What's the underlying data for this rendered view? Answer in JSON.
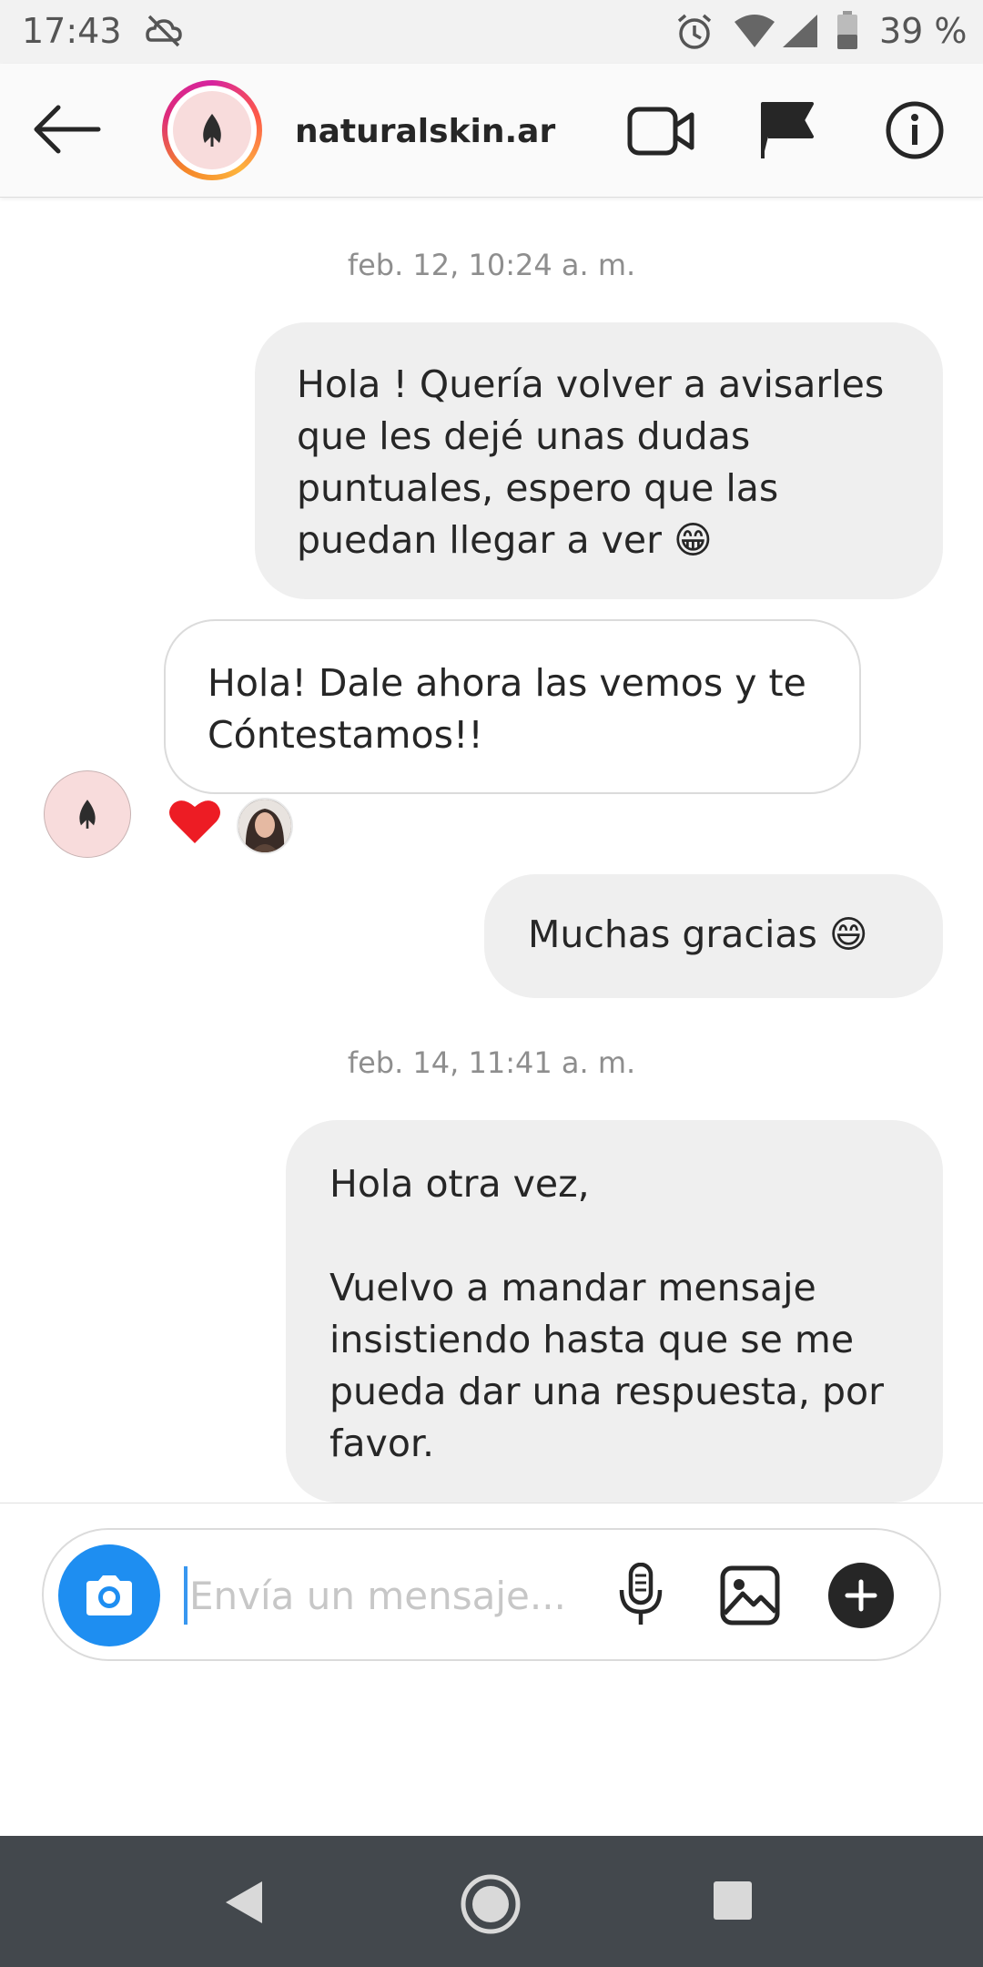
{
  "status_bar": {
    "time": "17:43",
    "battery": "39 %",
    "icons": [
      "sync-off-icon",
      "alarm-icon",
      "wifi-icon",
      "signal-icon",
      "battery-icon"
    ]
  },
  "header": {
    "username": "naturalskin.ar",
    "icons": [
      "back-arrow-icon",
      "video-call-icon",
      "flag-icon",
      "info-icon"
    ]
  },
  "conversation": {
    "timestamp_1": "feb. 12, 10:24 a. m.",
    "msg_1": "Hola ! Quería volver a avisarles que les dejé unas dudas puntuales, espero que las puedan llegar a ver 😁",
    "msg_2": "Hola! Dale ahora las vemos y te Cóntestamos!!",
    "msg_2_reaction": "❤",
    "msg_3": "Muchas gracias 😄",
    "timestamp_2": "feb. 14, 11:41 a. m.",
    "msg_4": "Hola otra vez,\n\nVuelvo a mandar mensaje insistiendo hasta que se me pueda dar una respuesta, por favor."
  },
  "composer": {
    "placeholder": "Envía un mensaje...",
    "icons": [
      "camera-icon",
      "microphone-icon",
      "gallery-icon",
      "plus-icon"
    ]
  },
  "colors": {
    "camera_button": "#1e8ef1",
    "outgoing_bubble": "#efefef",
    "heart": "#ed1c24",
    "nav_bar": "#43484d"
  }
}
